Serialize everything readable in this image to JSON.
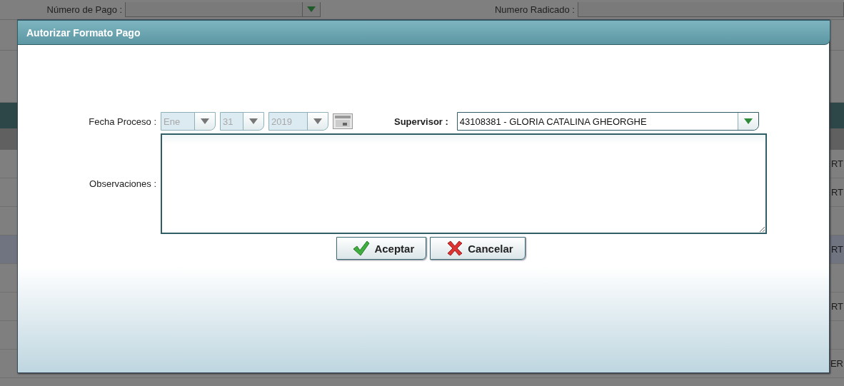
{
  "background": {
    "fields": [
      {
        "label": "Número de Pago :",
        "kind": "dropdown"
      },
      {
        "label": "Numero Radicado :",
        "kind": "text"
      }
    ],
    "rows": [
      {
        "text": "RT",
        "selected": false
      },
      {
        "text": "RT",
        "selected": false
      },
      {
        "selected": false
      },
      {
        "text": "RT",
        "selected": true
      },
      {
        "selected": false
      },
      {
        "text": "RT",
        "selected": false
      },
      {
        "selected": false
      },
      {
        "text": "ER",
        "selected": false
      }
    ]
  },
  "dialog": {
    "title": "Autorizar Formato Pago",
    "date": {
      "label": "Fecha Proceso :",
      "month": "Ene",
      "day": "31",
      "year": "2019",
      "disabled": true
    },
    "supervisor": {
      "label": "Supervisor :",
      "value": "43108381 - GLORIA CATALINA GHEORGHE"
    },
    "observations": {
      "label": "Observaciones :"
    },
    "buttons": [
      {
        "label": "Aceptar",
        "kind": "accept"
      },
      {
        "label": "Cancelar",
        "kind": "cancel"
      }
    ]
  }
}
